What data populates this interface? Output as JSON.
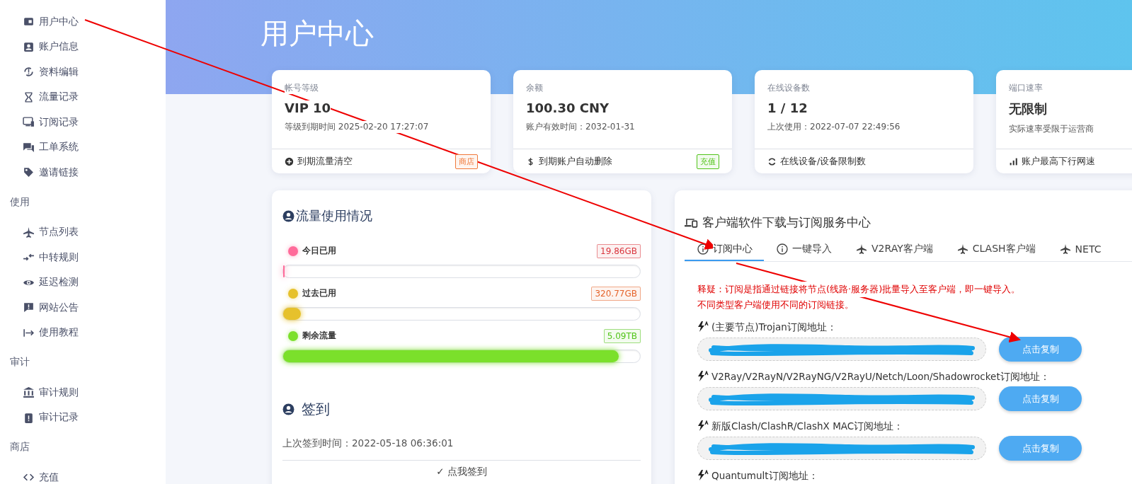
{
  "sidebar": {
    "sections": [
      {
        "items": [
          {
            "label": "用户中心"
          },
          {
            "label": "账户信息"
          },
          {
            "label": "资料编辑"
          },
          {
            "label": "流量记录"
          },
          {
            "label": "订阅记录"
          },
          {
            "label": "工单系统"
          },
          {
            "label": "邀请链接"
          }
        ]
      },
      {
        "title": "使用",
        "items": [
          {
            "label": "节点列表"
          },
          {
            "label": "中转规则"
          },
          {
            "label": "延迟检测"
          },
          {
            "label": "网站公告"
          },
          {
            "label": "使用教程"
          }
        ]
      },
      {
        "title": "审计",
        "items": [
          {
            "label": "审计规则"
          },
          {
            "label": "审计记录"
          }
        ]
      },
      {
        "title": "商店",
        "items": [
          {
            "label": "充值"
          }
        ]
      }
    ]
  },
  "page_title": "用户中心",
  "stat_cards": [
    {
      "label": "帐号等级",
      "value": "VIP 10",
      "detail": "等级到期时间 2025-02-20 17:27:07",
      "footer": "到期流量清空",
      "badge": {
        "text": "商店",
        "color": "#f0793a"
      }
    },
    {
      "label": "余额",
      "value": "100.30 CNY",
      "detail": "账户有效时间：2032-01-31",
      "footer": "到期账户自动删除",
      "badge": {
        "text": "充值",
        "color": "#52c41a"
      }
    },
    {
      "label": "在线设备数",
      "value": "1 / 12",
      "detail": "上次使用：2022-07-07 22:49:56",
      "footer": "在线设备/设备限制数"
    },
    {
      "label": "端口速率",
      "value": "无限制",
      "detail": "实际速率受限于运营商",
      "footer": "账户最高下行网速"
    }
  ],
  "traffic": {
    "title": "流量使用情况",
    "rows": [
      {
        "label": "今日已用",
        "value": "19.86GB",
        "color": "#ff6b9a",
        "level": 0.003
      },
      {
        "label": "过去已用",
        "value": "320.77GB",
        "color": "#e6c12c",
        "level": 0.05
      },
      {
        "label": "剩余流量",
        "value": "5.09TB",
        "color": "#7be02b",
        "level": 0.94
      }
    ]
  },
  "checkin": {
    "title": "签到",
    "last_time": "上次签到时间：2022-05-18 06:36:01",
    "button": "✓ 点我签到"
  },
  "client": {
    "title": "客户端软件下载与订阅服务中心",
    "tabs": [
      {
        "label": "订阅中心",
        "selected": true
      },
      {
        "label": "一键导入",
        "selected": false
      },
      {
        "label": "V2RAY客户端",
        "selected": false
      },
      {
        "label": "CLASH客户端",
        "selected": false
      },
      {
        "label": "NETC",
        "selected": false
      }
    ],
    "notes": [
      "释疑：订阅是指通过链接将节点(线路·服务器)批量导入至客户端，即一键导入。",
      "不同类型客户端使用不同的订阅链接。"
    ],
    "subscriptions": [
      {
        "label": "(主要节点)Trojan订阅地址：",
        "button": "点击复制"
      },
      {
        "label": "V2Ray/V2RayN/V2RayNG/V2RayU/Netch/Loon/Shadowrocket订阅地址：",
        "button": "点击复制"
      },
      {
        "label": "新版Clash/ClashR/ClashX MAC订阅地址：",
        "button": "点击复制"
      },
      {
        "label": "Quantumult订阅地址："
      }
    ]
  },
  "annotations": [
    {
      "kind": "arrow"
    },
    {
      "kind": "arrow"
    }
  ]
}
